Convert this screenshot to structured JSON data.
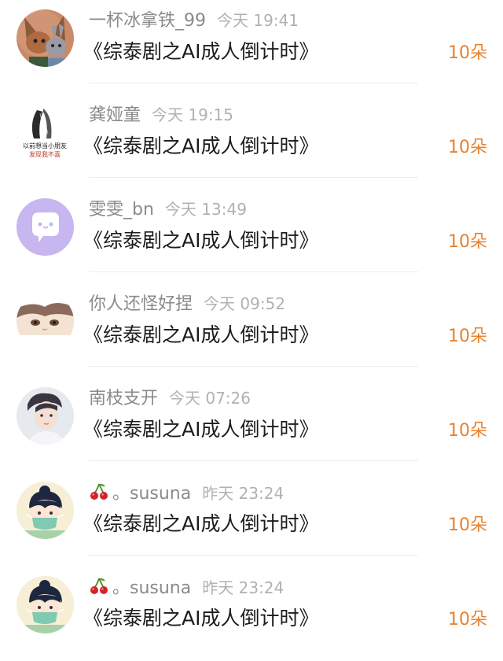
{
  "comments": [
    {
      "username": "一杯冰拿铁_99",
      "time": "今天 19:41",
      "title": "《综泰剧之AI成人倒计时》",
      "gift": "10朵",
      "avatar_icon": "zootopia-avatar-icon"
    },
    {
      "username": "龚娅童",
      "time": "今天 19:15",
      "title": "《综泰剧之AI成人倒计时》",
      "gift": "10朵",
      "avatar_icon": "sketch-text-avatar-icon",
      "avatar_text": [
        "以前想当小朋友",
        "发现我不喜"
      ]
    },
    {
      "username": "雯雯_bn",
      "time": "今天 13:49",
      "title": "《综泰剧之AI成人倒计时》",
      "gift": "10朵",
      "avatar_icon": "chat-bubble-avatar-icon"
    },
    {
      "username": "你人还怪好捏",
      "time": "今天 09:52",
      "title": "《综泰剧之AI成人倒计时》",
      "gift": "10朵",
      "avatar_icon": "anime-boy-avatar-icon"
    },
    {
      "username": "南枝支开",
      "time": "今天 07:26",
      "title": "《综泰剧之AI成人倒计时》",
      "gift": "10朵",
      "avatar_icon": "portrait-avatar-icon"
    },
    {
      "username": "。susuna",
      "time": "昨天 23:24",
      "title": "《综泰剧之AI成人倒计时》",
      "gift": "10朵",
      "avatar_icon": "cartoon-mask-avatar-icon",
      "name_prefix_icon": "cherry-icon"
    },
    {
      "username": "。susuna",
      "time": "昨天 23:24",
      "title": "《综泰剧之AI成人倒计时》",
      "gift": "10朵",
      "avatar_icon": "cartoon-mask-avatar-icon",
      "name_prefix_icon": "cherry-icon"
    }
  ],
  "colors": {
    "username": "#8a8a8a",
    "time": "#b1b1b1",
    "title": "#1c1c1c",
    "gift": "#e8812d",
    "divider": "#ececec"
  }
}
